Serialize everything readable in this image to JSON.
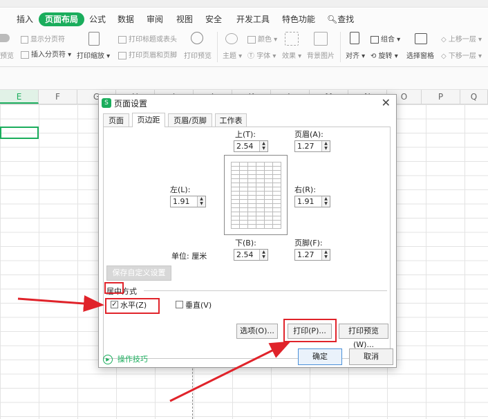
{
  "ribbon": {
    "tabs": [
      "插入",
      "页面布局",
      "公式",
      "数据",
      "审阅",
      "视图",
      "安全",
      "开发工具",
      "特色功能",
      "查找"
    ],
    "active_tab": "页面布局",
    "tools": {
      "show_page_break": "显示分页符",
      "insert_page_break": "插入分页符",
      "print_preview_small": "预览",
      "print_scale": "打印缩放",
      "print_titles": "打印标题或表头",
      "print_header_footer": "打印页眉和页脚",
      "print_preview": "打印预览",
      "theme": "主题",
      "colors": "颜色",
      "fonts": "字体",
      "effects": "效果",
      "background": "背景图片",
      "align": "对齐",
      "group": "组合",
      "rotate": "旋转",
      "select_pane": "选择窗格",
      "bring_forward": "上移一层",
      "send_backward": "下移一层"
    }
  },
  "columns": [
    "E",
    "F",
    "G",
    "H",
    "I",
    "J",
    "K",
    "L",
    "M",
    "N",
    "O",
    "P",
    "Q"
  ],
  "dialog": {
    "title": "页面设置",
    "tabs": [
      "页面",
      "页边距",
      "页眉/页脚",
      "工作表"
    ],
    "active_tab": "页边距",
    "top": {
      "label": "上(T):",
      "value": "2.54"
    },
    "header": {
      "label": "页眉(A):",
      "value": "1.27"
    },
    "left": {
      "label": "左(L):",
      "value": "1.91"
    },
    "right": {
      "label": "右(R):",
      "value": "1.91"
    },
    "bottom": {
      "label": "下(B):",
      "value": "2.54"
    },
    "footer": {
      "label": "页脚(F):",
      "value": "1.27"
    },
    "unit": "单位: 厘米",
    "save_custom": "保存自定义设置(S)",
    "center_section": "居中方式",
    "horizontal": {
      "label": "水平(Z)",
      "checked": true
    },
    "vertical": {
      "label": "垂直(V)",
      "checked": false
    },
    "options_button": "选项(O)...",
    "print_button": "打印(P)...",
    "print_preview_button": "打印预览(W)...",
    "tips_link": "操作技巧",
    "ok_button": "确定",
    "cancel_button": "取消"
  },
  "colors": {
    "accent": "#1aad5c",
    "highlight": "#e0232a"
  }
}
